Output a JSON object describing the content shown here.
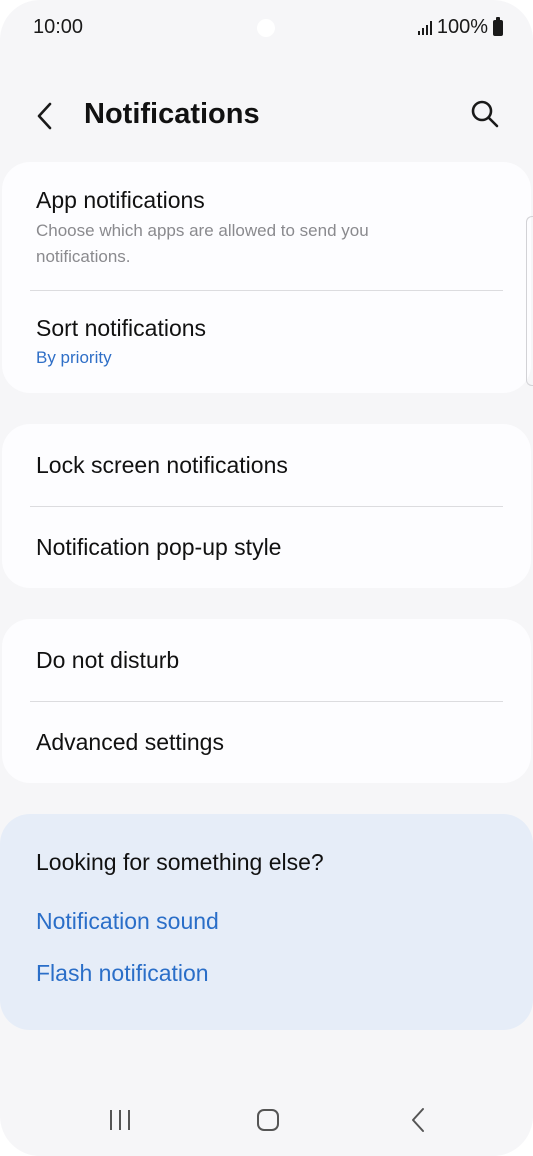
{
  "status_bar": {
    "time": "10:00",
    "battery": "100%"
  },
  "header": {
    "title": "Notifications",
    "back_icon": "chevron-left-icon",
    "search_icon": "search-icon"
  },
  "sections": {
    "app_notifications": {
      "title": "App notifications",
      "subtitle": "Choose which apps are allowed to send you notifications."
    },
    "sort_notifications": {
      "title": "Sort notifications",
      "value": "By priority"
    },
    "lock_screen": {
      "title": "Lock screen notifications"
    },
    "popup_style": {
      "title": "Notification pop-up style"
    },
    "do_not_disturb": {
      "title": "Do not disturb"
    },
    "advanced": {
      "title": "Advanced settings"
    }
  },
  "suggestions": {
    "title": "Looking for something else?",
    "links": [
      "Notification sound",
      "Flash notification"
    ]
  },
  "colors": {
    "accent": "#2f6fc7",
    "background": "#f6f6f8",
    "card": "#fdfdff",
    "suggest_background": "#e6edf8"
  }
}
